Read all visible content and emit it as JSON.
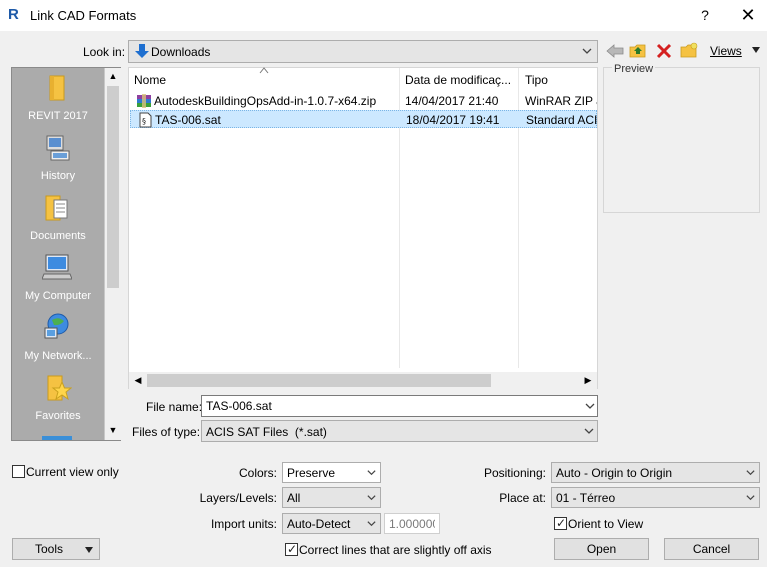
{
  "window": {
    "logo_letter": "R",
    "title": "Link CAD Formats",
    "help": "?",
    "close": "✕"
  },
  "lookin": {
    "label": "Look in:",
    "value": "Downloads"
  },
  "toolbar": {
    "views_label": "Views"
  },
  "places": [
    {
      "label": "REVIT 2017",
      "icon": "folder-icon"
    },
    {
      "label": "History",
      "icon": "history-icon"
    },
    {
      "label": "Documents",
      "icon": "documents-icon"
    },
    {
      "label": "My Computer",
      "icon": "computer-icon"
    },
    {
      "label": "My Network...",
      "icon": "network-icon"
    },
    {
      "label": "Favorites",
      "icon": "favorites-icon"
    }
  ],
  "file_list": {
    "columns": [
      "Nome",
      "Data de modificaç...",
      "Tipo"
    ],
    "rows": [
      {
        "name": "AutodeskBuildingOpsAdd-in-1.0.7-x64.zip",
        "date": "14/04/2017 21:40",
        "type": "WinRAR ZIP a",
        "icon": "zip-archive-icon"
      },
      {
        "name": "TAS-006.sat",
        "date": "18/04/2017 19:41",
        "type": "Standard ACIS",
        "icon": "sat-file-icon"
      }
    ]
  },
  "preview": {
    "label": "Preview"
  },
  "filename": {
    "label": "File name:",
    "value": "TAS-006.sat"
  },
  "filetype": {
    "label": "Files of type:",
    "value": "ACIS SAT Files  (*.sat)"
  },
  "options": {
    "current_view_only": {
      "label": "Current view only",
      "checked": false
    },
    "colors": {
      "label": "Colors:",
      "value": "Preserve"
    },
    "layers": {
      "label": "Layers/Levels:",
      "value": "All"
    },
    "import_units": {
      "label": "Import units:",
      "value": "Auto-Detect"
    },
    "scale": {
      "value": "1.000000"
    },
    "correct_lines": {
      "label": "Correct lines that are slightly off axis",
      "checked": true
    },
    "positioning": {
      "label": "Positioning:",
      "value": "Auto - Origin to Origin"
    },
    "place_at": {
      "label": "Place at:",
      "value": "01 - Térreo"
    },
    "orient_to_view": {
      "label": "Orient to View",
      "checked": true
    }
  },
  "buttons": {
    "tools": "Tools",
    "open": "Open",
    "cancel": "Cancel"
  },
  "colors": {
    "accent": "#1e5aa8",
    "selection": "#cce8ff",
    "places_bg": "#ababab",
    "delete_red": "#d42020",
    "folder_yellow": "#f5c242"
  }
}
